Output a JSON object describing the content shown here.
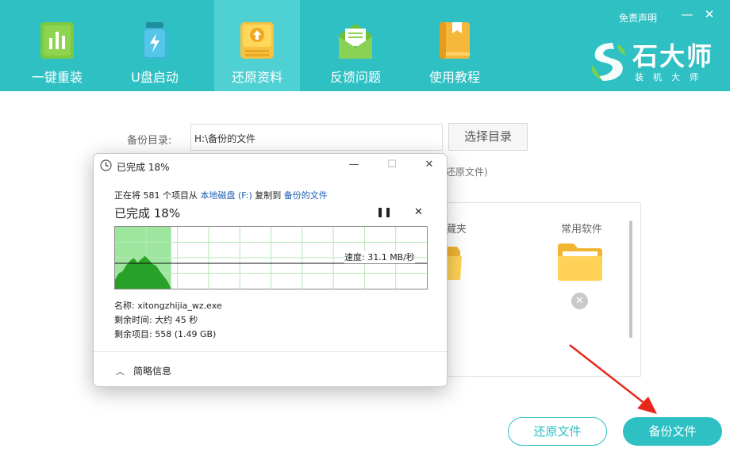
{
  "header": {
    "disclaimer": "免责声明",
    "minimize": "—",
    "close": "✕",
    "logo_title": "石大师",
    "logo_sub": "装机大师",
    "nav": [
      {
        "label": "一键重装",
        "icon": "bar-chart-icon"
      },
      {
        "label": "U盘启动",
        "icon": "usb-drive-icon"
      },
      {
        "label": "还原资料",
        "icon": "restore-upload-icon",
        "active": true
      },
      {
        "label": "反馈问题",
        "icon": "mail-envelope-icon"
      },
      {
        "label": "使用教程",
        "icon": "book-icon"
      }
    ]
  },
  "backup": {
    "label": "备份目录:",
    "path": "H:\\备份的文件",
    "choose_button": "选择目录",
    "hint": "还原文件)"
  },
  "folders": [
    {
      "label": "藏夹",
      "icon": "folder-icon"
    },
    {
      "label": "常用软件",
      "icon": "folder-icon"
    }
  ],
  "buttons": {
    "restore": "还原文件",
    "backup": "备份文件"
  },
  "dialog": {
    "title": "已完成 18%",
    "minimize": "—",
    "maximize": "☐",
    "close": "✕",
    "line_prefix": "正在将 581 个项目从 ",
    "source": "本地磁盘 (F:)",
    "line_middle": " 复制到 ",
    "destination": "备份的文件",
    "heading": "已完成 18%",
    "pause": "❚❚",
    "stop": "✕",
    "progress": 0.18,
    "speed": "速度: 31.1 MB/秒",
    "name": "名称: xitongzhijia_wz.exe",
    "time_remaining": "剩余时间: 大约 45 秒",
    "items_remaining": "剩余项目: 558 (1.49 GB)",
    "details_toggle": "简略信息",
    "chevron": "︿"
  },
  "colors": {
    "accent": "#2fc0c4",
    "progress_fill": "#9ee59e",
    "speed_fill": "#27a127",
    "link": "#1a5fb4"
  }
}
